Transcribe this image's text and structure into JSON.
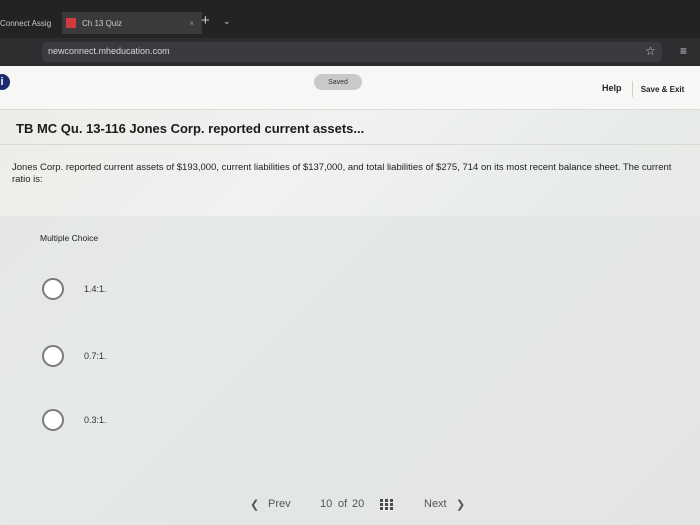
{
  "browser": {
    "tabs": [
      {
        "label": "Connect Assig"
      },
      {
        "label": "Ch 13 Quiz",
        "close": "×"
      }
    ],
    "new_tab": "+",
    "tab_menu": "⌄",
    "url": "newconnect.mheducation.com",
    "bookmark_icon": "star-icon",
    "menu_icon": "reading-list-icon"
  },
  "header": {
    "info_icon": "i",
    "saved": "Saved",
    "help": "Help",
    "save_exit": "Save & Exit"
  },
  "question": {
    "title": "TB MC Qu. 13-116 Jones Corp. reported current assets...",
    "text": "Jones Corp. reported current assets of $193,000, current liabilities of $137,000, and total liabilities of $275, 714 on its most recent balance sheet. The current ratio is:"
  },
  "multiple_choice": {
    "label": "Multiple Choice",
    "options": [
      "1.4:1.",
      "0.7:1.",
      "0.3:1."
    ]
  },
  "pagination": {
    "prev": "Prev",
    "current": "10",
    "of": "of",
    "total": "20",
    "next": "Next"
  },
  "colors": {
    "info_badge": "#1c2a6e",
    "tab_favicon": "#d23b3b"
  }
}
